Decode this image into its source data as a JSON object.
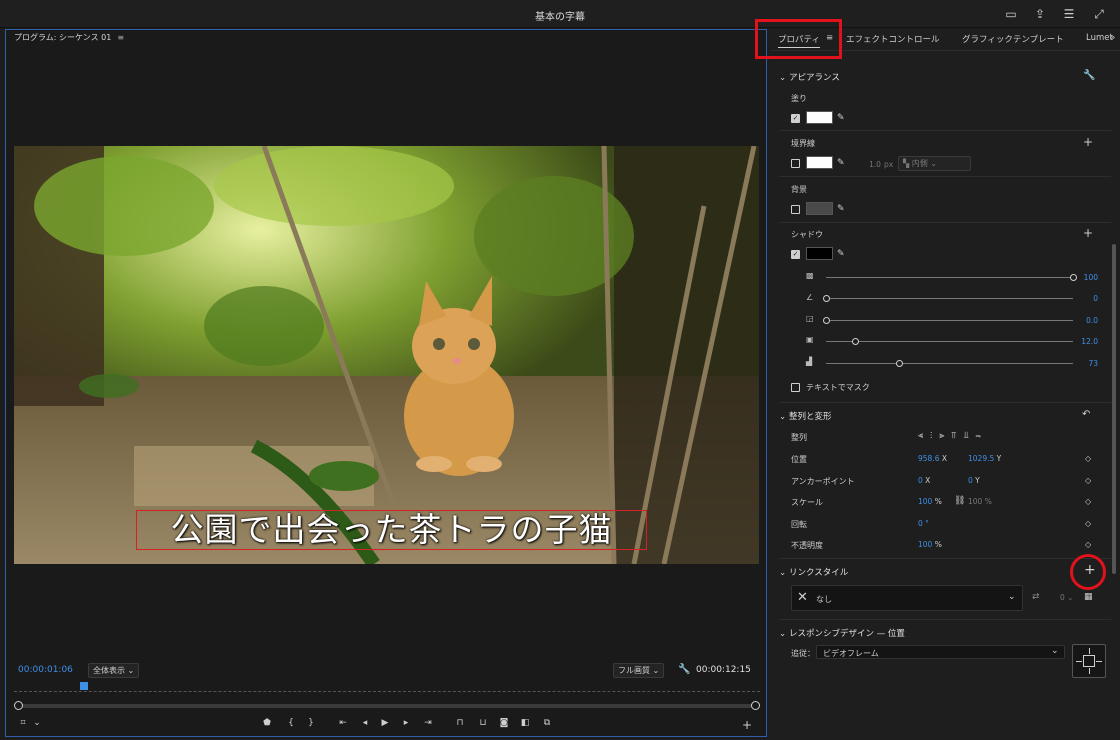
{
  "app": {
    "title": "基本の字幕"
  },
  "monitor": {
    "title": "プログラム: シーケンス 01",
    "menu_icon": "≡",
    "caption": "公園で出会った茶トラの子猫",
    "current_time": "00:00:01:06",
    "zoom": "全体表示",
    "quality": "フル画質",
    "duration": "00:00:12:15"
  },
  "panel": {
    "tabs": [
      "プロパティ",
      "≡",
      "エフェクトコントロール",
      "グラフィックテンプレート",
      "Lumet",
      "»"
    ],
    "appearance": {
      "header": "アピアランス",
      "fill_label": "塗り",
      "stroke_label": "境界線",
      "stroke_width": "1.0",
      "stroke_unit": "px",
      "stroke_position": "内側",
      "background_label": "背景",
      "shadow_label": "シャドウ",
      "shadow_values": [
        "100",
        "0",
        "0.0",
        "12.0",
        "73"
      ],
      "text_mask": "テキストでマスク"
    },
    "transform": {
      "header": "整列と変形",
      "align_label": "整列",
      "position_label": "位置",
      "position_x": "958.6",
      "position_x_axis": "X",
      "position_y": "1029.5",
      "position_y_axis": "Y",
      "anchor_label": "アンカーポイント",
      "anchor_x": "0",
      "anchor_x_axis": "X",
      "anchor_y": "0",
      "anchor_y_axis": "Y",
      "scale_label": "スケール",
      "scale_value": "100",
      "scale_unit": "%",
      "scale_linked": "100 %",
      "rotation_label": "回転",
      "rotation_value": "0 °",
      "opacity_label": "不透明度",
      "opacity_value": "100",
      "opacity_unit": "%"
    },
    "linked_style": {
      "header": "リンクスタイル",
      "none_label": "なし",
      "count": "0"
    },
    "responsive": {
      "header": "レスポンシブデザイン — 位置",
      "follow_label": "追従：",
      "follow_value": "ビデオフレーム"
    }
  }
}
